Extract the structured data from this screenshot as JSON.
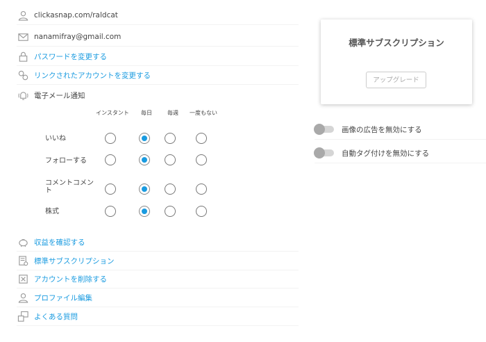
{
  "profile": {
    "website": "clickasnap.com/raldcat",
    "email": "nanamifray@gmail.com",
    "change_password": "パスワードを変更する",
    "change_linked": "リンクされたアカウントを変更する",
    "email_notifications": "電子メール通知"
  },
  "notifications": {
    "columns": [
      "インスタント",
      "毎日",
      "毎週",
      "一度もない"
    ],
    "rows": [
      {
        "label": "いいね",
        "selected": 1
      },
      {
        "label": "フォローする",
        "selected": 1
      },
      {
        "label": "コメントコメント",
        "selected": 1
      },
      {
        "label": "株式",
        "selected": 1
      }
    ]
  },
  "menu": {
    "earnings": "収益を確認する",
    "subscription": "標準サブスクリプション",
    "delete_account": "アカウントを削除する",
    "edit_profile": "プロファイル編集",
    "faq": "よくある質問"
  },
  "plan_card": {
    "title": "標準サブスクリプション",
    "upgrade": "アップグレード"
  },
  "toggles": {
    "disable_ads": "画像の広告を無効にする",
    "disable_autotag": "自動タグ付けを無効にする"
  },
  "colors": {
    "link": "#1a9be0",
    "radio_selected": "#1a9be0",
    "toggle_knob": "#a9a9a9"
  }
}
